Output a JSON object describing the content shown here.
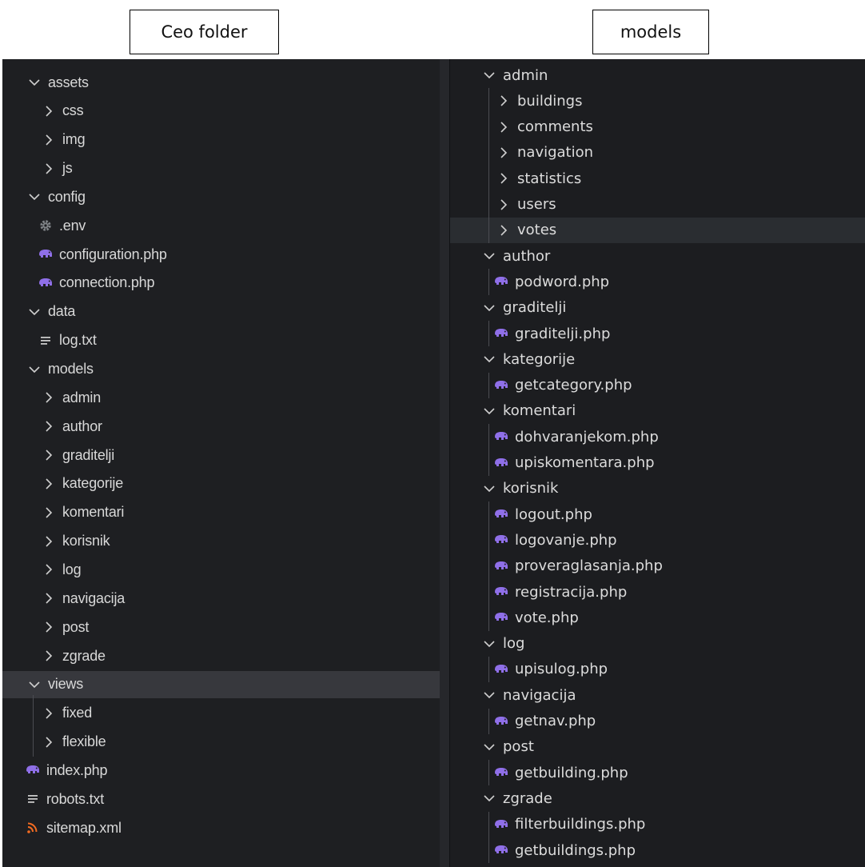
{
  "captions": {
    "left": "Ceo folder",
    "right": "models"
  },
  "colors": {
    "php_icon": "#8f6fe8",
    "env_icon": "#7f8387",
    "rss_icon": "#f36b21",
    "txt_icon": "#c8c8c8",
    "row_selected": "#37383d"
  },
  "left_tree": [
    {
      "label": "assets",
      "kind": "folder-open",
      "depth": 0
    },
    {
      "label": "css",
      "kind": "folder",
      "depth": 1
    },
    {
      "label": "img",
      "kind": "folder",
      "depth": 1
    },
    {
      "label": "js",
      "kind": "folder",
      "depth": 1
    },
    {
      "label": "config",
      "kind": "folder-open",
      "depth": 0
    },
    {
      "label": ".env",
      "kind": "gear",
      "depth": 1
    },
    {
      "label": "configuration.php",
      "kind": "php",
      "depth": 1
    },
    {
      "label": "connection.php",
      "kind": "php",
      "depth": 1
    },
    {
      "label": "data",
      "kind": "folder-open",
      "depth": 0
    },
    {
      "label": "log.txt",
      "kind": "txt",
      "depth": 1
    },
    {
      "label": "models",
      "kind": "folder-open",
      "depth": 0
    },
    {
      "label": "admin",
      "kind": "folder",
      "depth": 1
    },
    {
      "label": "author",
      "kind": "folder",
      "depth": 1
    },
    {
      "label": "graditelji",
      "kind": "folder",
      "depth": 1
    },
    {
      "label": "kategorije",
      "kind": "folder",
      "depth": 1
    },
    {
      "label": "komentari",
      "kind": "folder",
      "depth": 1
    },
    {
      "label": "korisnik",
      "kind": "folder",
      "depth": 1
    },
    {
      "label": "log",
      "kind": "folder",
      "depth": 1
    },
    {
      "label": "navigacija",
      "kind": "folder",
      "depth": 1
    },
    {
      "label": "post",
      "kind": "folder",
      "depth": 1
    },
    {
      "label": "zgrade",
      "kind": "folder",
      "depth": 1
    },
    {
      "label": "views",
      "kind": "folder-open",
      "depth": 0,
      "selected": true
    },
    {
      "label": "fixed",
      "kind": "folder",
      "depth": 1
    },
    {
      "label": "flexible",
      "kind": "folder",
      "depth": 1
    },
    {
      "label": "index.php",
      "kind": "php",
      "depth": 0
    },
    {
      "label": "robots.txt",
      "kind": "txt",
      "depth": 0
    },
    {
      "label": "sitemap.xml",
      "kind": "rss",
      "depth": 0
    }
  ],
  "right_tree": [
    {
      "label": "admin",
      "kind": "folder-open",
      "depth": 0
    },
    {
      "label": "buildings",
      "kind": "folder",
      "depth": 1
    },
    {
      "label": "comments",
      "kind": "folder",
      "depth": 1
    },
    {
      "label": "navigation",
      "kind": "folder",
      "depth": 1
    },
    {
      "label": "statistics",
      "kind": "folder",
      "depth": 1
    },
    {
      "label": "users",
      "kind": "folder",
      "depth": 1
    },
    {
      "label": "votes",
      "kind": "folder",
      "depth": 1,
      "selected": true
    },
    {
      "label": "author",
      "kind": "folder-open",
      "depth": 0
    },
    {
      "label": "podword.php",
      "kind": "php",
      "depth": 1
    },
    {
      "label": "graditelji",
      "kind": "folder-open",
      "depth": 0
    },
    {
      "label": "graditelji.php",
      "kind": "php",
      "depth": 1
    },
    {
      "label": "kategorije",
      "kind": "folder-open",
      "depth": 0
    },
    {
      "label": "getcategory.php",
      "kind": "php",
      "depth": 1
    },
    {
      "label": "komentari",
      "kind": "folder-open",
      "depth": 0
    },
    {
      "label": "dohvaranjekom.php",
      "kind": "php",
      "depth": 1
    },
    {
      "label": "upiskomentara.php",
      "kind": "php",
      "depth": 1
    },
    {
      "label": "korisnik",
      "kind": "folder-open",
      "depth": 0
    },
    {
      "label": "logout.php",
      "kind": "php",
      "depth": 1
    },
    {
      "label": "logovanje.php",
      "kind": "php",
      "depth": 1
    },
    {
      "label": "proveraglasanja.php",
      "kind": "php",
      "depth": 1
    },
    {
      "label": "registracija.php",
      "kind": "php",
      "depth": 1
    },
    {
      "label": "vote.php",
      "kind": "php",
      "depth": 1
    },
    {
      "label": "log",
      "kind": "folder-open",
      "depth": 0
    },
    {
      "label": "upisulog.php",
      "kind": "php",
      "depth": 1
    },
    {
      "label": "navigacija",
      "kind": "folder-open",
      "depth": 0
    },
    {
      "label": "getnav.php",
      "kind": "php",
      "depth": 1
    },
    {
      "label": "post",
      "kind": "folder-open",
      "depth": 0
    },
    {
      "label": "getbuilding.php",
      "kind": "php",
      "depth": 1
    },
    {
      "label": "zgrade",
      "kind": "folder-open",
      "depth": 0
    },
    {
      "label": "filterbuildings.php",
      "kind": "php",
      "depth": 1
    },
    {
      "label": "getbuildings.php",
      "kind": "php",
      "depth": 1
    }
  ]
}
